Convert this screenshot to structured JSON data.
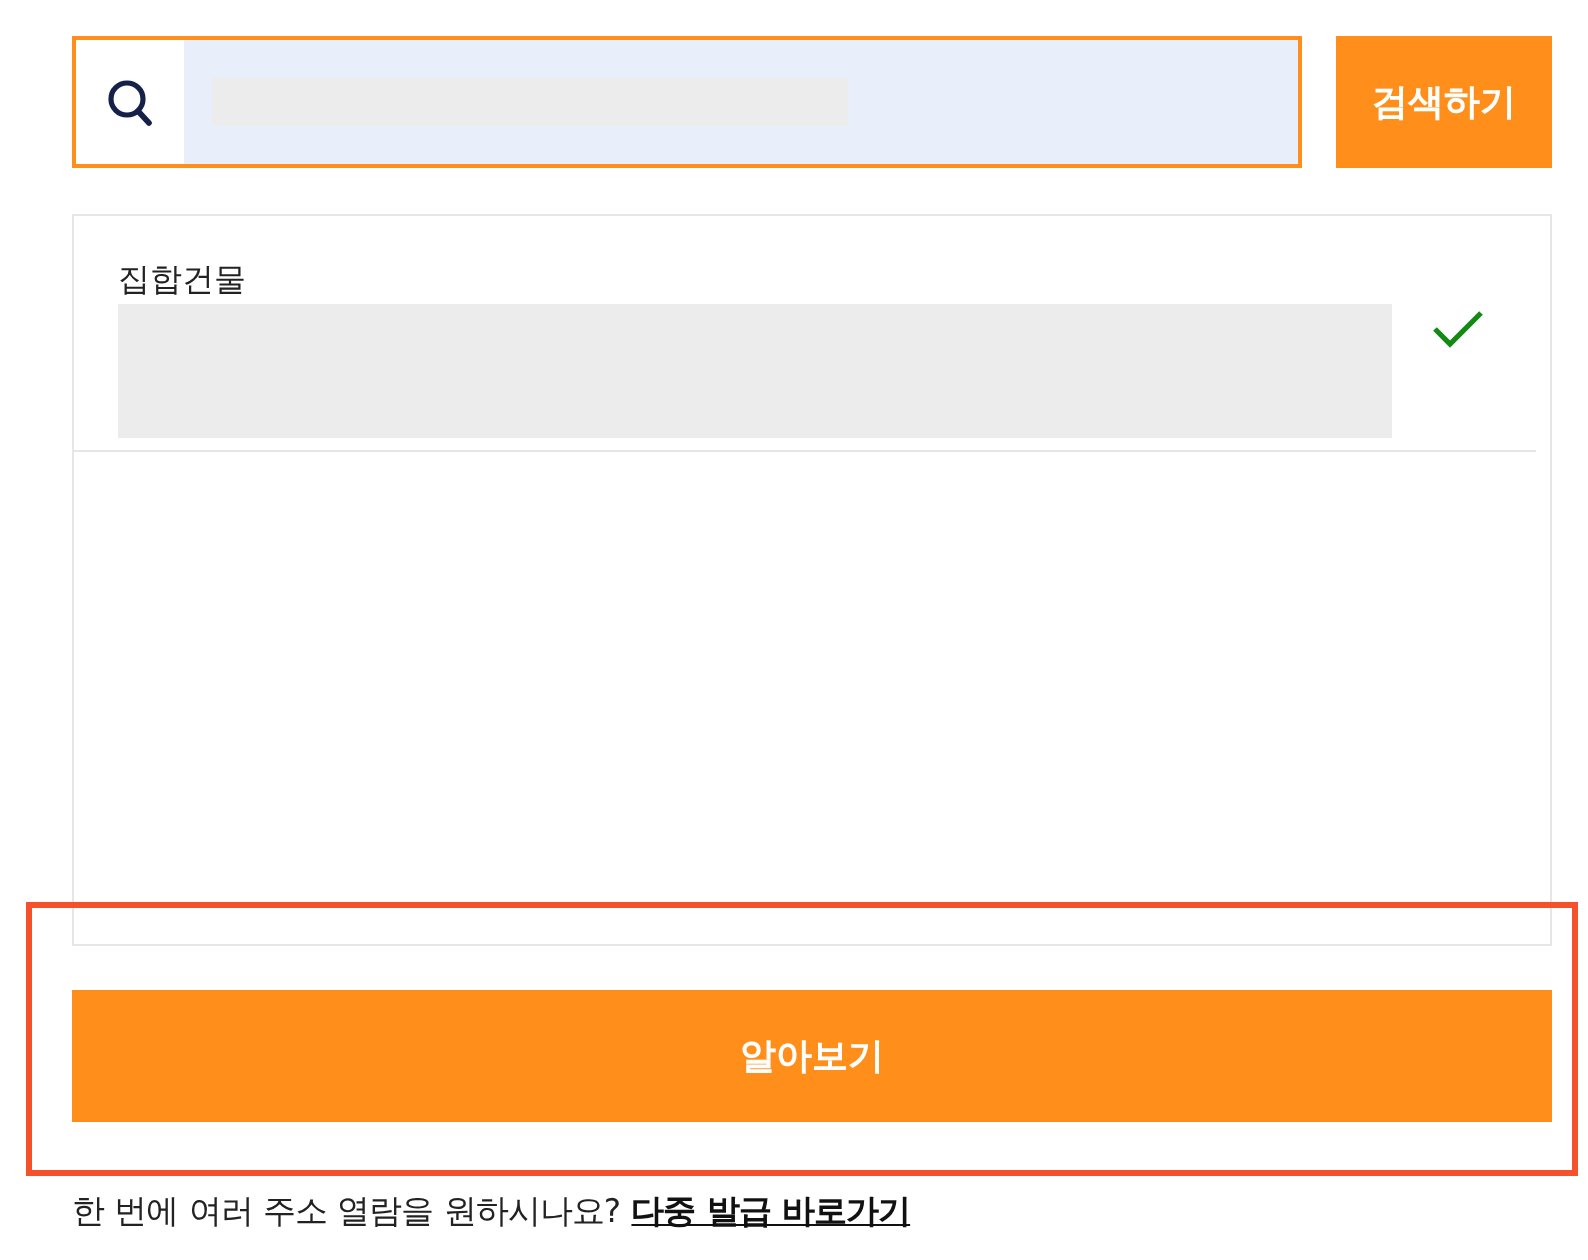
{
  "search": {
    "focused": true,
    "button": "검색하기"
  },
  "results": [
    {
      "category": "집합건물",
      "selected": true
    }
  ],
  "primary_button": "알아보기",
  "highlight_frame": true,
  "footer": {
    "text": "한 번에 여러 주소 열람을 원하시나요?",
    "link": "다중 발급 바로가기"
  }
}
